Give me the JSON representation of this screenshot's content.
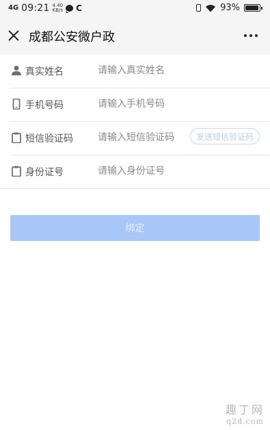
{
  "status_bar": {
    "network": "4G",
    "time": "09:21",
    "speed_value": "4.40",
    "speed_unit": "KB/s",
    "c_icon": "C",
    "battery_percent": "93%",
    "battery_level": 0.93
  },
  "header": {
    "title": "成都公安微户政"
  },
  "form": {
    "rows": [
      {
        "label": "真实姓名",
        "placeholder": "请输入真实姓名",
        "value": "",
        "icon": "person-icon"
      },
      {
        "label": "手机号码",
        "placeholder": "请输入手机号码",
        "value": "",
        "icon": "phone-icon"
      },
      {
        "label": "短信验证码",
        "placeholder": "请输入短信验证码",
        "value": "",
        "icon": "clipboard-icon"
      },
      {
        "label": "身份证号",
        "placeholder": "请输入身份证号",
        "value": "",
        "icon": "clipboard-icon"
      }
    ],
    "sms_button": "发送短信验证码"
  },
  "bind_button": "绑定",
  "watermark": {
    "top": "趣丁网",
    "bottom": "q2d.com"
  },
  "colors": {
    "accent": "#a9c6f8",
    "header_bg": "#f5f5f5",
    "sms_border": "#c3d7f5"
  }
}
